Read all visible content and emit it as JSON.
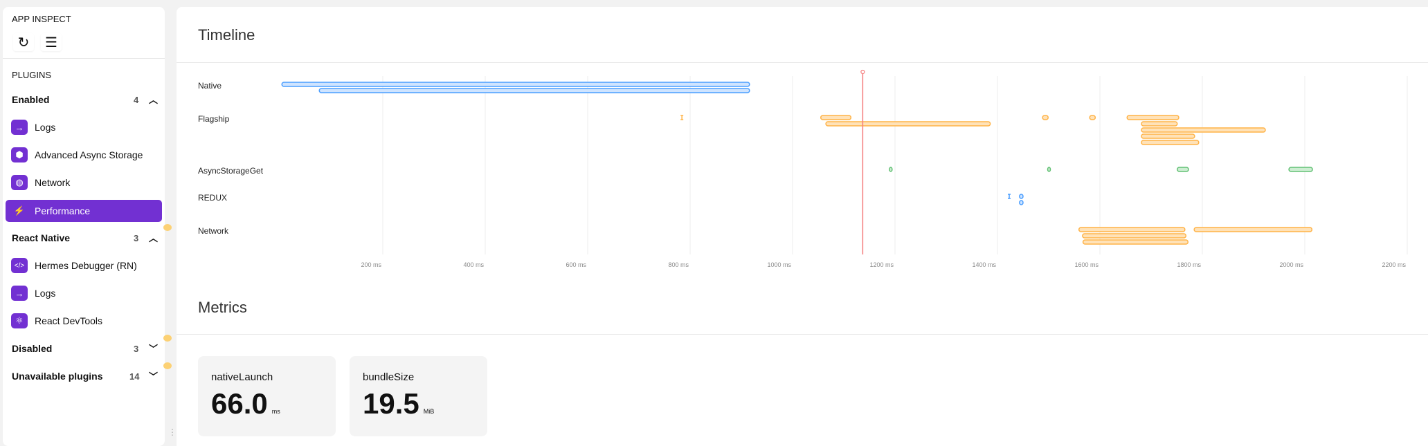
{
  "sidebar": {
    "title": "APP INSPECT",
    "section_label": "PLUGINS",
    "groups": [
      {
        "label": "Enabled",
        "count": "4",
        "expanded": true,
        "items": [
          {
            "label": "Logs",
            "icon": "arrow-right-icon",
            "glyph": "→"
          },
          {
            "label": "Advanced Async Storage",
            "icon": "box-icon",
            "glyph": "⬢"
          },
          {
            "label": "Network",
            "icon": "globe-icon",
            "glyph": "◍"
          },
          {
            "label": "Performance",
            "icon": "lightning-icon",
            "glyph": "⚡",
            "active": true
          }
        ]
      },
      {
        "label": "React Native",
        "count": "3",
        "expanded": true,
        "items": [
          {
            "label": "Hermes Debugger (RN)",
            "icon": "code-icon",
            "glyph": "</>"
          },
          {
            "label": "Logs",
            "icon": "arrow-right-icon",
            "glyph": "→"
          },
          {
            "label": "React DevTools",
            "icon": "atom-icon",
            "glyph": "⚛"
          }
        ]
      },
      {
        "label": "Disabled",
        "count": "3",
        "expanded": false
      },
      {
        "label": "Unavailable plugins",
        "count": "14",
        "expanded": false
      }
    ]
  },
  "timeline": {
    "title": "Timeline",
    "colors": {
      "blue": "#4a9eff",
      "orange": "#ffb347",
      "green": "#62c074",
      "red": "#f47c7c"
    },
    "chart_data": {
      "type": "timeline",
      "x_unit": "ms",
      "xlim": [
        0,
        2250
      ],
      "ticks": [
        "200 ms",
        "400 ms",
        "600 ms",
        "800 ms",
        "1000 ms",
        "1200 ms",
        "1400 ms",
        "1600 ms",
        "1800 ms",
        "2000 ms",
        "2200 ms"
      ],
      "tick_values": [
        200,
        400,
        600,
        800,
        1000,
        1200,
        1400,
        1600,
        1800,
        2000,
        2200
      ],
      "marker_ms": 1137,
      "tracks": [
        {
          "name": "Native",
          "color": "blue",
          "spans": [
            [
              3,
              916,
              0
            ],
            [
              76,
              916,
              1
            ]
          ],
          "points": []
        },
        {
          "name": "Flagship",
          "color": "orange",
          "spans": [
            [
              1055,
              1114,
              0
            ],
            [
              1065,
              1386,
              1
            ],
            [
              1488,
              1499,
              0
            ],
            [
              1580,
              1591,
              0
            ],
            [
              1653,
              1754,
              0
            ],
            [
              1681,
              1751,
              1
            ],
            [
              1681,
              1923,
              2
            ],
            [
              1681,
              1785,
              3
            ],
            [
              1681,
              1793,
              4
            ]
          ],
          "points": [
            [
              784,
              0
            ]
          ]
        },
        {
          "name": "AsyncStorageGet",
          "color": "green",
          "spans": [
            [
              1189,
              1193,
              0
            ],
            [
              1498,
              1502,
              0
            ],
            [
              1751,
              1773,
              0
            ],
            [
              1969,
              2015,
              0
            ]
          ],
          "points": []
        },
        {
          "name": "REDUX",
          "color": "blue",
          "spans": [
            [
              1443,
              1450,
              0
            ],
            [
              1443,
              1450,
              1
            ]
          ],
          "points": [
            [
              1423,
              0
            ]
          ]
        },
        {
          "name": "Network",
          "color": "orange",
          "spans": [
            [
              1559,
              1766,
              0
            ],
            [
              1784,
              2014,
              0
            ],
            [
              1566,
              1768,
              1
            ],
            [
              1567,
              1772,
              2
            ]
          ],
          "points": []
        }
      ]
    }
  },
  "metrics": {
    "title": "Metrics",
    "cards": [
      {
        "name": "nativeLaunch",
        "value": "66.0",
        "unit": "ms"
      },
      {
        "name": "bundleSize",
        "value": "19.5",
        "unit": "MiB"
      }
    ]
  }
}
